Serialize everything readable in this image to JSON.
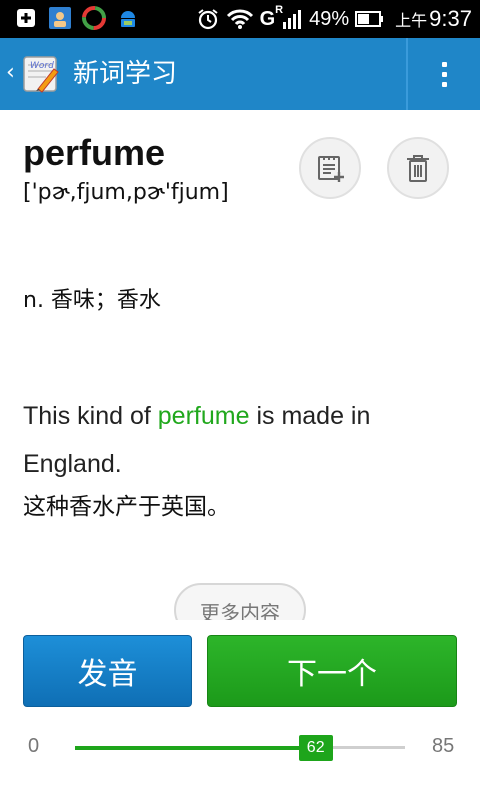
{
  "status_bar": {
    "network_type": "G",
    "roaming": "R",
    "battery": "49%",
    "time_prefix": "上午",
    "time": "9:37",
    "icons": [
      "add-box-icon",
      "contact-card-icon",
      "sync-app-icon",
      "android-download-icon",
      "alarm-clock-icon",
      "wifi-icon",
      "signal-icon",
      "battery-icon"
    ]
  },
  "header": {
    "title": "新词学习",
    "background": "#1f86c8",
    "icons": [
      "back-chevron-icon",
      "app-logo-icon",
      "overflow-menu-icon"
    ]
  },
  "word": {
    "headword": "perfume",
    "phonetic": "['pɚ,fjum,pɚ'fjum]"
  },
  "actions": {
    "icons": [
      "add-to-notebook-icon",
      "trash-icon"
    ]
  },
  "definition": "n. 香味；香水",
  "example": {
    "before": "This kind of ",
    "highlight": "perfume",
    "after": " is made in England.",
    "translation": "这种香水产于英国。",
    "highlight_color": "#21a81d"
  },
  "more_label": "更多内容",
  "buttons": {
    "pronounce": "发音",
    "next": "下一个",
    "pronounce_color": "#1783cb",
    "next_color": "#22a51f"
  },
  "progress": {
    "min": "0",
    "max": "85",
    "current": "62",
    "color": "#1ea51b"
  }
}
